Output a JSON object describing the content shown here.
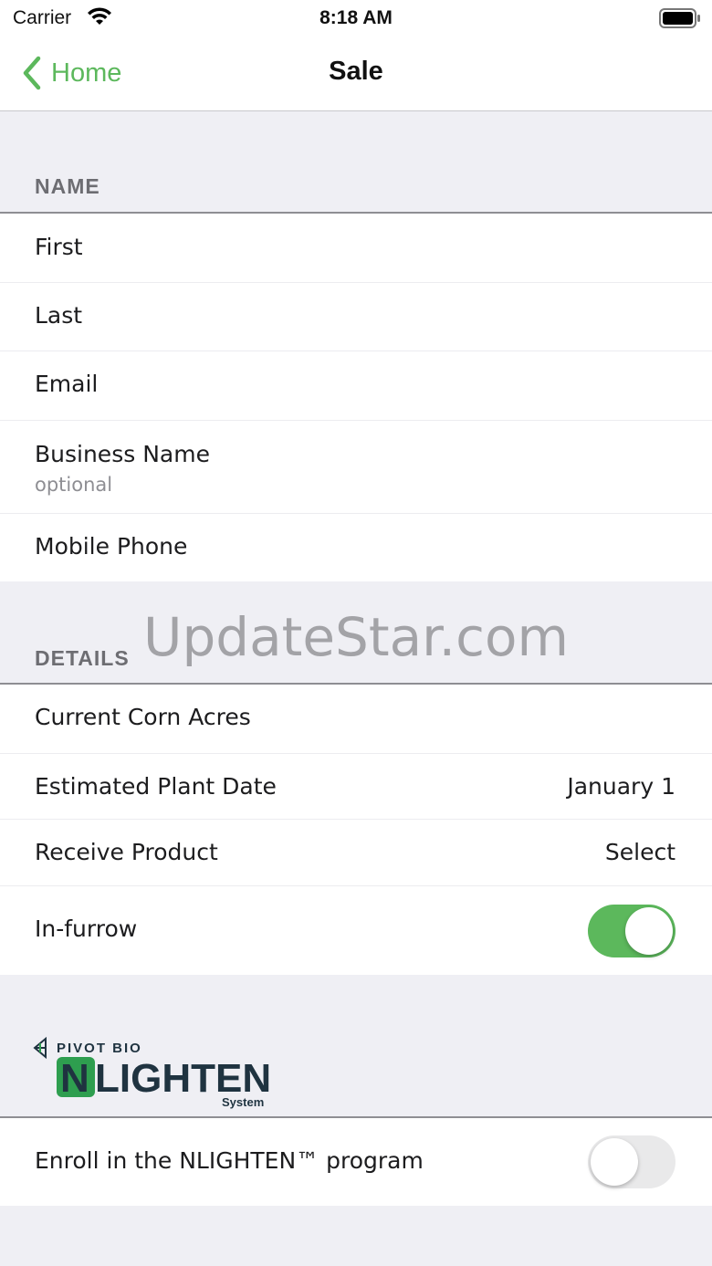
{
  "status_bar": {
    "carrier": "Carrier",
    "time": "8:18 AM",
    "icons": [
      "wifi-icon",
      "battery-icon"
    ]
  },
  "nav": {
    "back_label": "Home",
    "title": "Sale"
  },
  "sections": {
    "name": {
      "header": "NAME",
      "rows": [
        {
          "label": "First"
        },
        {
          "label": "Last"
        },
        {
          "label": "Email"
        },
        {
          "label": "Business Name",
          "sublabel": "optional"
        },
        {
          "label": "Mobile Phone"
        }
      ]
    },
    "details": {
      "header": "DETAILS",
      "rows": [
        {
          "label": "Current Corn Acres"
        },
        {
          "label": "Estimated Plant Date",
          "value": "January 1"
        },
        {
          "label": "Receive Product",
          "value": "Select"
        },
        {
          "label": "In-furrow",
          "toggle": true
        }
      ]
    },
    "nlighten": {
      "logo": {
        "brand": "PIVOT BIO",
        "product": "NLIGHTEN",
        "suffix": "System"
      },
      "rows": [
        {
          "label": "Enroll in the NLIGHTEN™ program",
          "toggle": false
        }
      ]
    }
  },
  "watermark": "UpdateStar.com",
  "colors": {
    "accent": "#5cb85c",
    "background": "#efeff4",
    "toggle_off": "#e9e9ea",
    "logo_dark": "#1f3340",
    "logo_green": "#2e9e4f"
  }
}
